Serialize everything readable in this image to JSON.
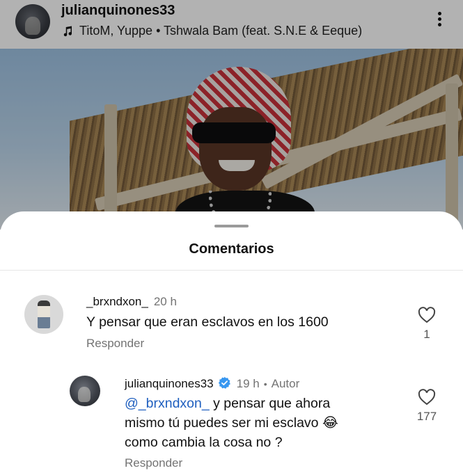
{
  "post": {
    "username": "julianquinones33",
    "music": "TitoM, Yuppe • Tshwala Bam (feat. S.N.E & Eeque)"
  },
  "sheet": {
    "title": "Comentarios"
  },
  "comments": [
    {
      "username": "_brxndxon_",
      "time": "20 h",
      "text": "Y pensar que eran esclavos en los 1600",
      "reply_label": "Responder",
      "likes": "1"
    }
  ],
  "replies": [
    {
      "username": "julianquinones33",
      "time": "19 h",
      "author_label": "Autor",
      "mention": "@_brxndxon_",
      "text_line1": " y pensar que ahora",
      "text_line2": "mismo tú puedes ser mi esclavo 😂",
      "text_line3": "como cambia la cosa no ?",
      "reply_label": "Responder",
      "likes": "177"
    }
  ],
  "icons": {
    "music": "music-note-icon",
    "more": "more-vertical-icon",
    "like": "heart-outline-icon",
    "verified": "verified-badge-icon"
  },
  "colors": {
    "verified": "#3897f0",
    "mention": "#1f5fbf",
    "muted": "#737373"
  }
}
